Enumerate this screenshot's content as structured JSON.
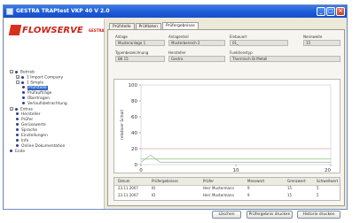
{
  "window": {
    "title": "GESTRA TRAPtest VKP 40 V 2.0",
    "minimize_glyph": "_",
    "maximize_glyph": "□",
    "close_glyph": "✕"
  },
  "logo": {
    "brand": "FLOWSERVE",
    "sub": "GESTRA"
  },
  "tree": [
    {
      "label": "Betrieb",
      "kind": "exp",
      "exp": "−",
      "indent": 0
    },
    {
      "label": "1 Import Company",
      "kind": "exp",
      "exp": "+",
      "indent": 1
    },
    {
      "label": "1 Simple",
      "kind": "exp",
      "exp": "−",
      "indent": 1
    },
    {
      "label": "Prüfstelle",
      "kind": "bullet",
      "indent": 2,
      "selected": true
    },
    {
      "label": "Prüfaufträge",
      "kind": "bullet",
      "indent": 2
    },
    {
      "label": "Übertragen",
      "kind": "bullet",
      "indent": 2
    },
    {
      "label": "Verlaufsbetrachtung",
      "kind": "bullet",
      "indent": 2
    },
    {
      "label": "Extras",
      "kind": "exp",
      "exp": "−",
      "indent": 0
    },
    {
      "label": "Hersteller",
      "kind": "bullet",
      "indent": 1
    },
    {
      "label": "Prüfer",
      "kind": "bullet",
      "indent": 1
    },
    {
      "label": "Gerüsswerte",
      "kind": "bullet",
      "indent": 1
    },
    {
      "label": "Sprache",
      "kind": "bullet",
      "indent": 1
    },
    {
      "label": "Einstellungen",
      "kind": "bullet",
      "indent": 1
    },
    {
      "label": "Info",
      "kind": "bullet",
      "indent": 1
    },
    {
      "label": "Online Dokumentation",
      "kind": "bullet",
      "indent": 1
    },
    {
      "label": "Ende",
      "kind": "bullet",
      "indent": 0
    }
  ],
  "tabs": [
    {
      "label": "Prüfstelle"
    },
    {
      "label": "Prüfdaten"
    },
    {
      "label": "Prüfergebnisse",
      "active": true
    }
  ],
  "fields": {
    "anlage": {
      "label": "Anlage",
      "value": "Musteranlage 1"
    },
    "anlagenteil": {
      "label": "Anlagenteil",
      "value": "Musterbereich 2"
    },
    "einbauort": {
      "label": "Einbauort",
      "value": "01_"
    },
    "nennweite": {
      "label": "Nennweite",
      "value": "15"
    },
    "typ": {
      "label": "Typenbezeichnung",
      "value": "BK 15"
    },
    "hersteller": {
      "label": "Hersteller",
      "value": "Gestra"
    },
    "funktion": {
      "label": "Funktionstyp",
      "value": "Thermisch Bi Metall"
    }
  },
  "chart_data": {
    "type": "line",
    "ylabel": "relativer Schall",
    "ylim": [
      0,
      100
    ],
    "xlim": [
      0,
      20
    ],
    "y_ticks": [
      "100",
      "80",
      "60",
      "40",
      "20",
      "0"
    ],
    "x_ticks": [
      "0",
      "10",
      "20"
    ],
    "series": [
      {
        "color": "#e8a0a0",
        "x": [
          0,
          20
        ],
        "y": [
          20,
          20
        ]
      },
      {
        "color": "#9ccf86",
        "x": [
          0,
          20
        ],
        "y": [
          7,
          7
        ]
      },
      {
        "color": "#b0b0b0",
        "x": [
          0,
          1,
          2,
          20
        ],
        "y": [
          3,
          12,
          3,
          3
        ]
      }
    ]
  },
  "table": {
    "headers": [
      "Datum",
      "Prüfergebnisse",
      "Prüfer",
      "Messwert",
      "Grenzwert",
      "Schwellwert"
    ],
    "rows": [
      [
        "23.11.2007",
        "IO",
        "Herr Mustermann",
        "9",
        "15",
        "5"
      ],
      [
        "23.11.2007",
        "IO",
        "Herr Mustermann",
        "9",
        "15",
        "5"
      ]
    ]
  },
  "buttons": {
    "delete": "Löschen",
    "print_results": "Prüfergebnis drucken",
    "print_history": "Historie drucken"
  }
}
